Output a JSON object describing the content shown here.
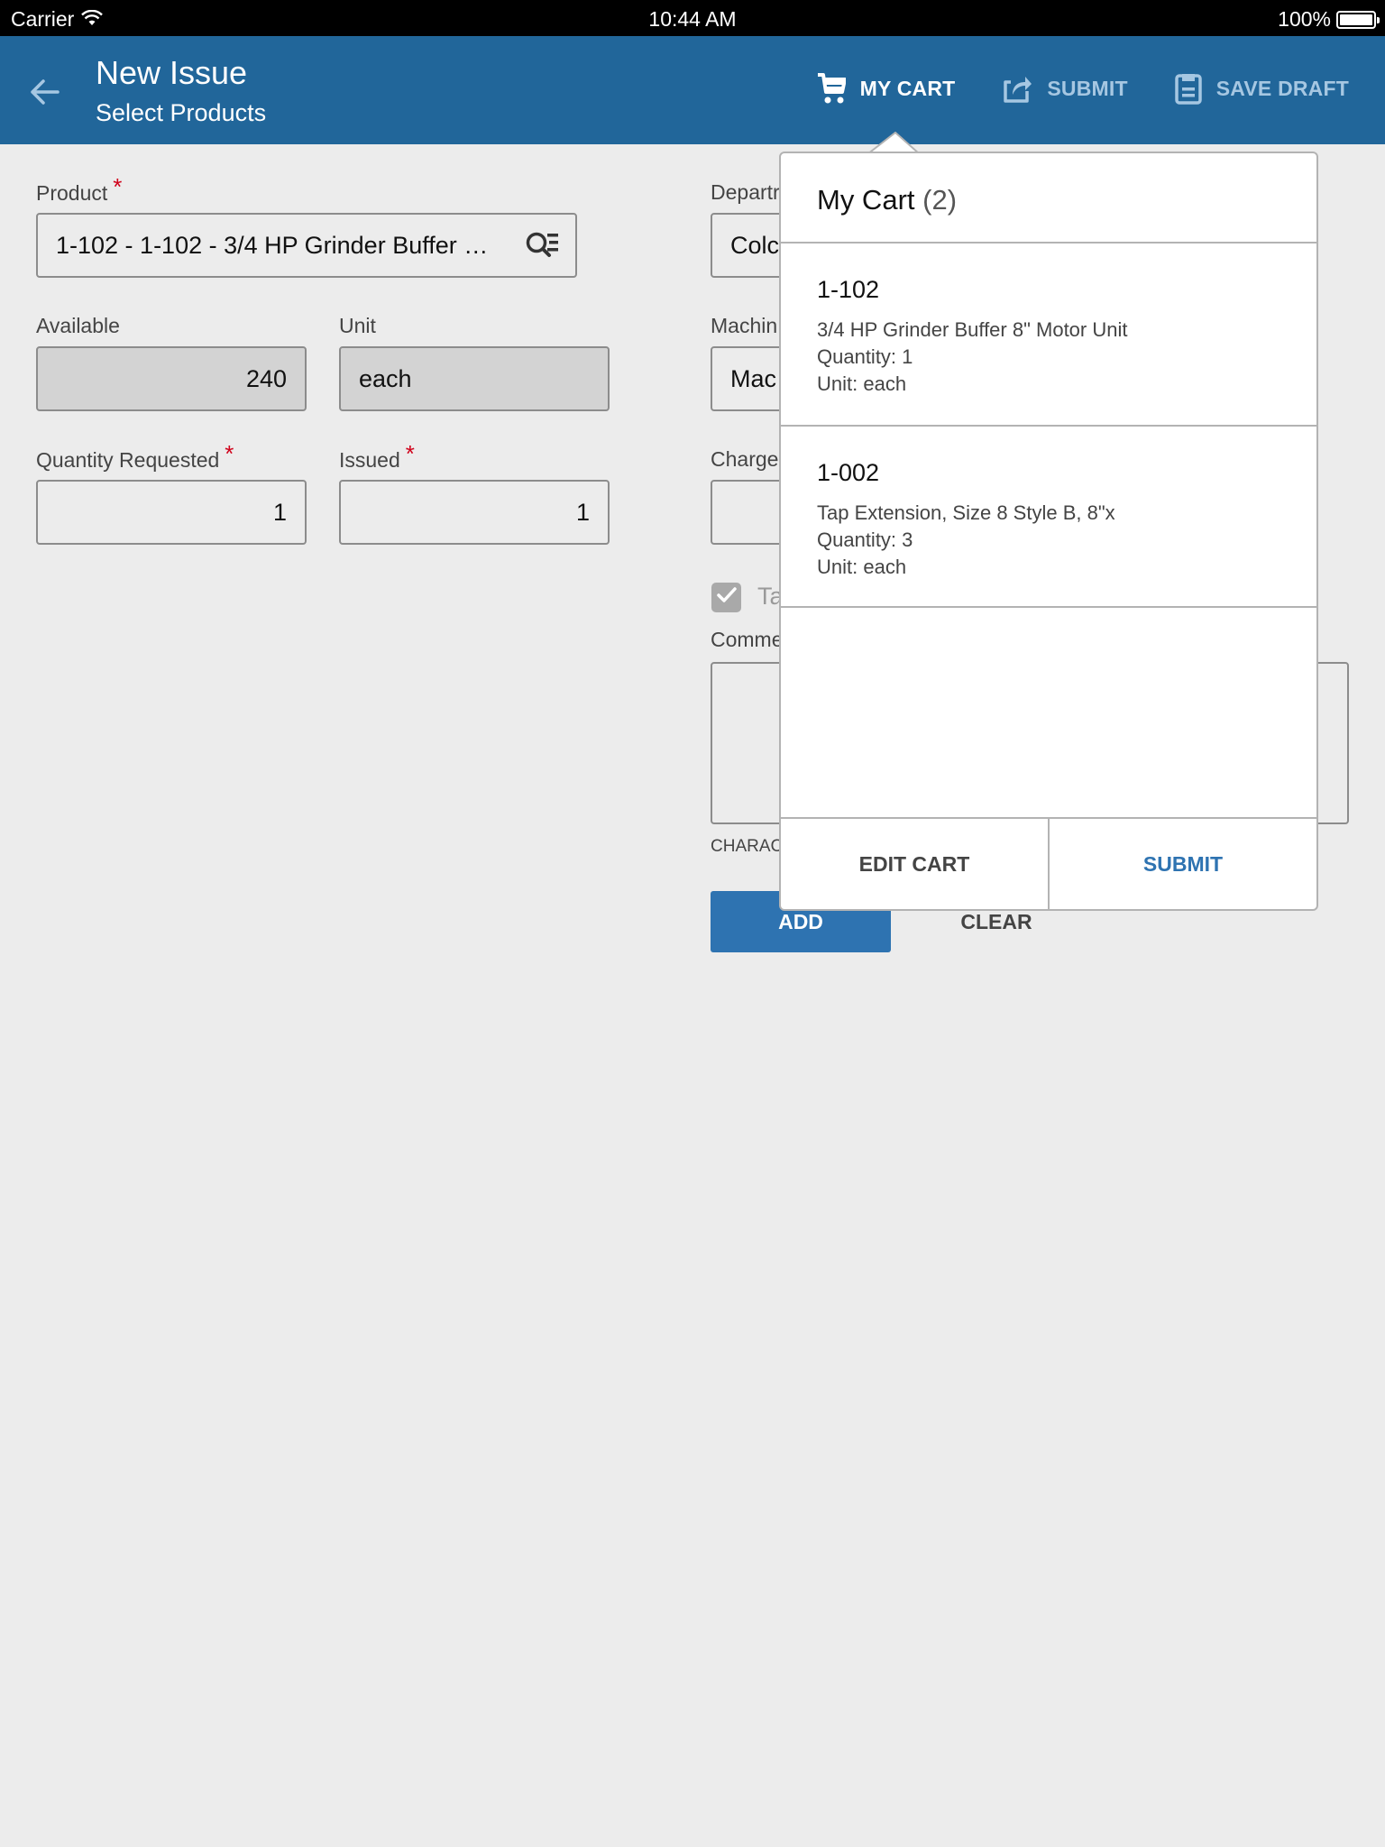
{
  "status_bar": {
    "carrier": "Carrier",
    "time": "10:44 AM",
    "battery_percent": "100%",
    "battery_level": 1.0
  },
  "header": {
    "title": "New Issue",
    "subtitle": "Select Products",
    "back_icon": "arrow-left-icon",
    "actions": [
      {
        "label": "MY CART",
        "icon": "cart-icon",
        "state": "active"
      },
      {
        "label": "SUBMIT",
        "icon": "share-icon",
        "state": "dim"
      },
      {
        "label": "SAVE DRAFT",
        "icon": "save-icon",
        "state": "dim"
      }
    ]
  },
  "colors": {
    "brand": "#21669a",
    "accent": "#2e73b1",
    "required": "#d0021b",
    "background": "#ececec"
  },
  "form": {
    "product": {
      "label": "Product",
      "required": "*",
      "value": "1-102 - 1-102 - 3/4 HP Grinder Buffer …",
      "icon": "search-list-icon"
    },
    "available": {
      "label": "Available",
      "value": "240"
    },
    "unit": {
      "label": "Unit",
      "value": "each"
    },
    "quantity_requested": {
      "label": "Quantity Requested",
      "required": "*",
      "value": "1"
    },
    "issued": {
      "label": "Issued",
      "required": "*",
      "value": "1"
    },
    "department": {
      "label": "Departr",
      "value": "Colc"
    },
    "machine": {
      "label": "Machin",
      "value": "Mac"
    },
    "charge": {
      "label": "Charge",
      "value": ""
    },
    "checkbox": {
      "label": "Ta",
      "checked": true
    },
    "comments": {
      "label": "Comme",
      "value": ""
    },
    "char_note": "CHARAC",
    "add_label": "ADD",
    "clear_label": "CLEAR"
  },
  "cart_popover": {
    "title": "My Cart",
    "count": "(2)",
    "items": [
      {
        "code": "1-102",
        "description": "3/4 HP Grinder Buffer 8\" Motor Unit",
        "quantity": "Quantity: 1",
        "unit": "Unit: each"
      },
      {
        "code": "1-002",
        "description": "Tap Extension, Size 8 Style B, 8\"x",
        "quantity": "Quantity: 3",
        "unit": "Unit: each"
      }
    ],
    "edit_label": "EDIT CART",
    "submit_label": "SUBMIT"
  }
}
